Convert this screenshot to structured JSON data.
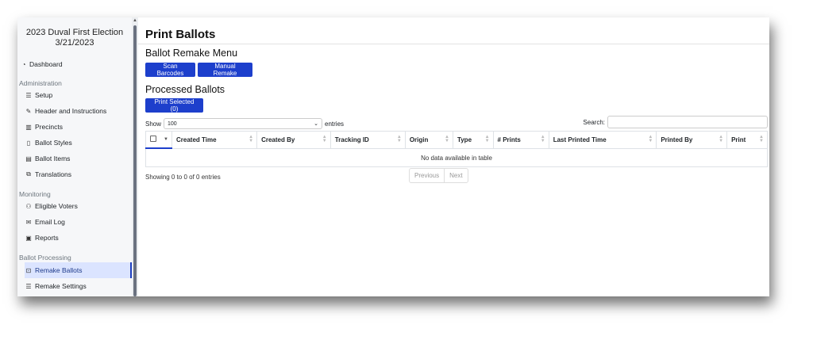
{
  "sidebar": {
    "title_line1": "2023 Duval First Election",
    "title_line2": "3/21/2023",
    "dashboard": "Dashboard",
    "sections": {
      "administration": "Administration",
      "monitoring": "Monitoring",
      "ballot_processing": "Ballot Processing"
    },
    "admin_items": [
      "Setup",
      "Header and Instructions",
      "Precincts",
      "Ballot Styles",
      "Ballot Items",
      "Translations"
    ],
    "monitoring_items": [
      "Eligible Voters",
      "Email Log",
      "Reports"
    ],
    "processing_items": [
      "Remake Ballots",
      "Remake Settings"
    ]
  },
  "main": {
    "title": "Print Ballots",
    "remake_menu_title": "Ballot Remake Menu",
    "scan_barcodes": "Scan Barcodes",
    "manual_remake": "Manual Remake",
    "processed_title": "Processed Ballots",
    "print_selected": "Print Selected (0)",
    "show_label": "Show",
    "show_value": "100",
    "entries_label": "entries",
    "search_label": "Search:",
    "columns": [
      "Created Time",
      "Created By",
      "Tracking ID",
      "Origin",
      "Type",
      "# Prints",
      "Last Printed Time",
      "Printed By",
      "Print"
    ],
    "empty_text": "No data available in table",
    "info_text": "Showing 0 to 0 of 0 entries",
    "prev": "Previous",
    "next": "Next"
  },
  "colors": {
    "accent": "#1d3fcc",
    "active_bg": "#dbe4ff"
  }
}
